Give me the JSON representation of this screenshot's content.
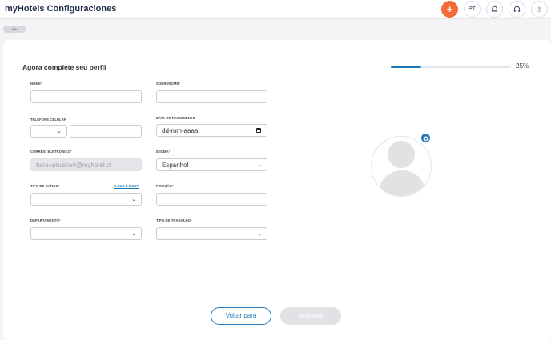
{
  "header": {
    "title": "myHotels Configuraciones",
    "add_label": "+",
    "language": "PT",
    "icons": [
      "plus-icon",
      "bell-icon",
      "support-icon",
      "user-icon"
    ]
  },
  "chip": {
    "label": "Sair"
  },
  "form": {
    "title": "Agora complete seu perfil",
    "progress_percent": 25,
    "progress_label": "25%",
    "fields": {
      "nome": {
        "label": "NOME",
        "value": ""
      },
      "sobrenome": {
        "label": "SOBRENOME",
        "value": ""
      },
      "telefone": {
        "label": "TELEFONE CELULAR",
        "code": "",
        "value": ""
      },
      "nascimento": {
        "label": "DATA DE NASCIMENTO",
        "value": "dd-mm-aaaa"
      },
      "email": {
        "label": "CORREIO ELETRÔNICO",
        "value": "tiare+prueba4@myhotel.cl"
      },
      "idioma": {
        "label": "IDIOMA",
        "value": "Espanhol"
      },
      "cargo": {
        "label": "TIPO DE CARGO",
        "help": "O QUE É ISSO?",
        "value": ""
      },
      "posicao": {
        "label": "POSIÇÃO",
        "value": ""
      },
      "departamento": {
        "label": "DEPARTAMENTO",
        "value": ""
      },
      "trabalho": {
        "label": "TIPO DE TRABALHO",
        "value": ""
      }
    },
    "buttons": {
      "back": "Voltar para",
      "next": "Seguinte"
    }
  },
  "colors": {
    "accent": "#1f7ab8",
    "add_button": "#f26b38"
  }
}
